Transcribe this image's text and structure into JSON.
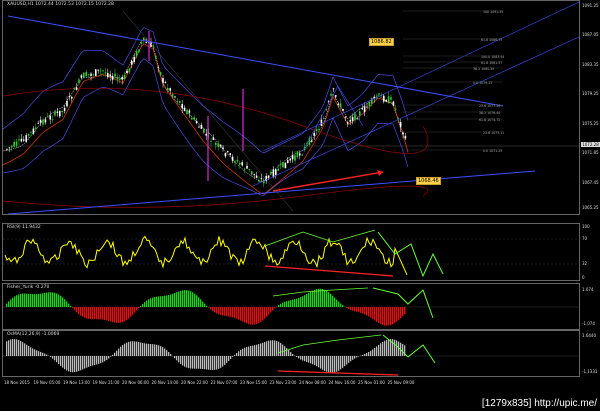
{
  "main": {
    "title": "XAUUSD,H1  1072.44  1072.53  1072.15  1072.28",
    "price_axis": [
      "1091.25",
      "1087.05",
      "1083.35",
      "1079.25",
      "1075.25",
      "1071.85",
      "1067.45",
      "1065.25"
    ],
    "current_price": "1072.28",
    "fib_levels": [
      "100  1091.25",
      "61.8  1086.75",
      "100.0  1083.54",
      "61.8  1081.57",
      "38.2  1080.35",
      "0.0  1079.13",
      "23.6  1077.30",
      "38.2  1076.44",
      "61.8  1074.72",
      "23.6  1073.11",
      "0.0  1071.23"
    ],
    "tags": [
      "1086.82",
      "1068.46"
    ]
  },
  "rsi": {
    "title": "RSI(9) 11.9432",
    "axis": [
      "100",
      "70",
      "32",
      "0"
    ]
  },
  "fisher": {
    "title": "Fisher_Yurik -0.270",
    "axis": [
      "1.074",
      "-1.074"
    ]
  },
  "osma": {
    "title": "OsMA(12,26,9) -1.0069",
    "axis": [
      "1.6440",
      "-1.1331"
    ]
  },
  "time_axis": [
    "18 Nov 2015",
    "19 Nov 05:00",
    "19 Nov 13:00",
    "19 Nov 21:00",
    "20 Nov 06:00",
    "20 Nov 14:00",
    "20 Nov 22:00",
    "23 Nov 07:00",
    "23 Nov 15:00",
    "23 Nov 23:00",
    "24 Nov 08:00",
    "24 Nov 16:00",
    "25 Nov 01:00",
    "25 Nov 09:00"
  ],
  "watermark": "[1279x835] http://upic.me/",
  "colors": {
    "bull": "#33cc33",
    "bear": "#ff2222",
    "trend": "#3b4fff",
    "rsi": "#ffff00",
    "arrow": "#66ff33",
    "bands": "#5555ff"
  }
}
